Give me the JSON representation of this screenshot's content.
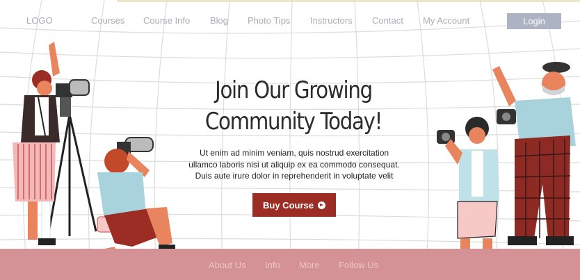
{
  "nav": {
    "logo": "LOGO",
    "links": [
      "Courses",
      "Course Info",
      "Blog",
      "Photo Tips",
      "Instructors",
      "Contact",
      "My Account"
    ],
    "login_label": "Login"
  },
  "hero": {
    "title_line1": "Join Our Growing",
    "title_line2": "Community Today!",
    "text_line1": "Ut enim ad minim veniam, quis nostrud exercitation",
    "text_line2": "ullamco laboris nisi ut aliquip ex ea commodo consequat.",
    "text_line3": "Duis aute irure dolor in reprehenderit in voluptate velit",
    "button_label": "Buy Course",
    "button_icon": "arrow-circle-right-icon"
  },
  "footer": {
    "links": [
      "About Us",
      "Info",
      "More",
      "Follow Us"
    ]
  },
  "colors": {
    "accent": "#9b2d24",
    "footer_bg": "#d49296",
    "login_bg": "#adb3c2",
    "nav_text": "#a9adb7"
  }
}
